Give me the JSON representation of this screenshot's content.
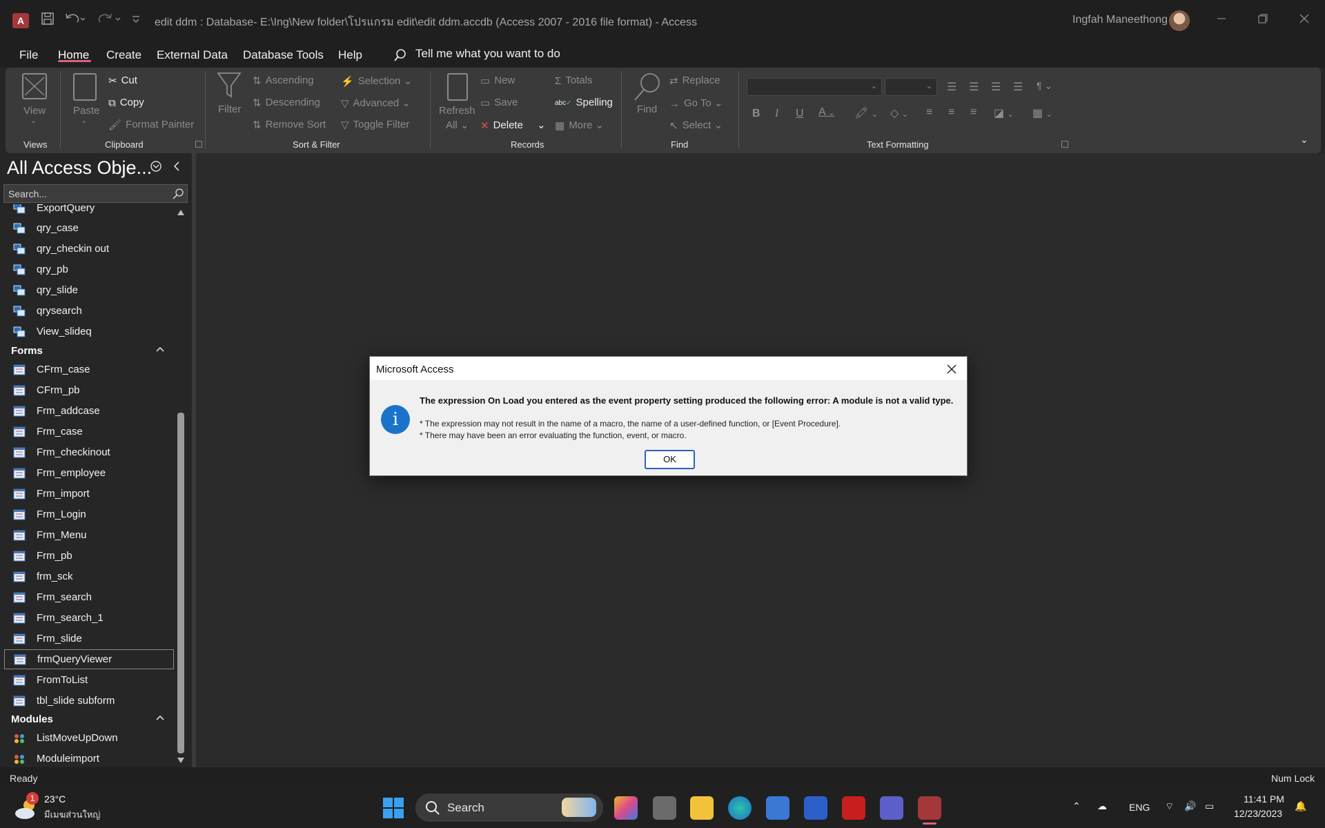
{
  "window": {
    "title": "edit ddm : Database- E:\\Ing\\New folder\\โปรแกรม edit\\edit ddm.accdb (Access 2007 - 2016 file format)  -  Access",
    "app_logo": "A",
    "user_name": "Ingfah Maneethong"
  },
  "menu": {
    "tabs": [
      "File",
      "Home",
      "Create",
      "External Data",
      "Database Tools",
      "Help"
    ],
    "active_tab": "Home",
    "tell_me": "Tell me what you want to do"
  },
  "ribbon": {
    "views": {
      "view": "View",
      "group": "Views"
    },
    "clipboard": {
      "paste": "Paste",
      "cut": "Cut",
      "copy": "Copy",
      "format_painter": "Format Painter",
      "group": "Clipboard"
    },
    "sort_filter": {
      "filter": "Filter",
      "ascending": "Ascending",
      "descending": "Descending",
      "remove_sort": "Remove Sort",
      "selection": "Selection",
      "advanced": "Advanced",
      "toggle_filter": "Toggle Filter",
      "group": "Sort & Filter"
    },
    "records": {
      "refresh": "Refresh",
      "refresh_all": "All",
      "new": "New",
      "save": "Save",
      "delete": "Delete",
      "totals": "Totals",
      "spelling": "Spelling",
      "spelling_abc": "abc",
      "more": "More",
      "group": "Records"
    },
    "find": {
      "find": "Find",
      "replace": "Replace",
      "goto": "Go To",
      "select": "Select",
      "group": "Find"
    },
    "text_formatting": {
      "bold": "B",
      "italic": "I",
      "underline": "U",
      "font_color": "A",
      "group": "Text Formatting"
    }
  },
  "nav": {
    "title": "All Access Obje...",
    "search_placeholder": "Search...",
    "partial_item": "ExportQuery",
    "queries": [
      "qry_case",
      "qry_checkin out",
      "qry_pb",
      "qry_slide",
      "qrysearch",
      "View_slideq"
    ],
    "forms_header": "Forms",
    "forms": [
      "CFrm_case",
      "CFrm_pb",
      "Frm_addcase",
      "Frm_case",
      "Frm_checkinout",
      "Frm_employee",
      "Frm_import",
      "Frm_Login",
      "Frm_Menu",
      "Frm_pb",
      "frm_sck",
      "Frm_search",
      "Frm_search_1",
      "Frm_slide",
      "frmQueryViewer",
      "FromToList",
      "tbl_slide subform"
    ],
    "selected_form": "frmQueryViewer",
    "modules_header": "Modules",
    "modules": [
      "ListMoveUpDown",
      "Moduleimport"
    ]
  },
  "status": {
    "left": "Ready",
    "right": "Num Lock"
  },
  "dialog": {
    "title": "Microsoft Access",
    "icon": "i",
    "message": "The expression On Load you entered as the event property setting produced the following error: A module is not a valid type.",
    "detail1": "* The expression may not result in the name of a macro, the name of a user-defined function, or [Event Procedure].",
    "detail2": "* There may have been an error evaluating the function, event, or macro.",
    "ok": "OK"
  },
  "taskbar": {
    "weather_temp": "23°C",
    "weather_desc": "มีเมฆส่วนใหญ่",
    "weather_badge": "1",
    "search": "Search",
    "language": "ENG",
    "time": "11:41 PM",
    "date": "12/23/2023"
  },
  "colors": {
    "accent": "#e0607e",
    "access_red": "#a4373a",
    "dialog_info": "#1a73c8"
  }
}
